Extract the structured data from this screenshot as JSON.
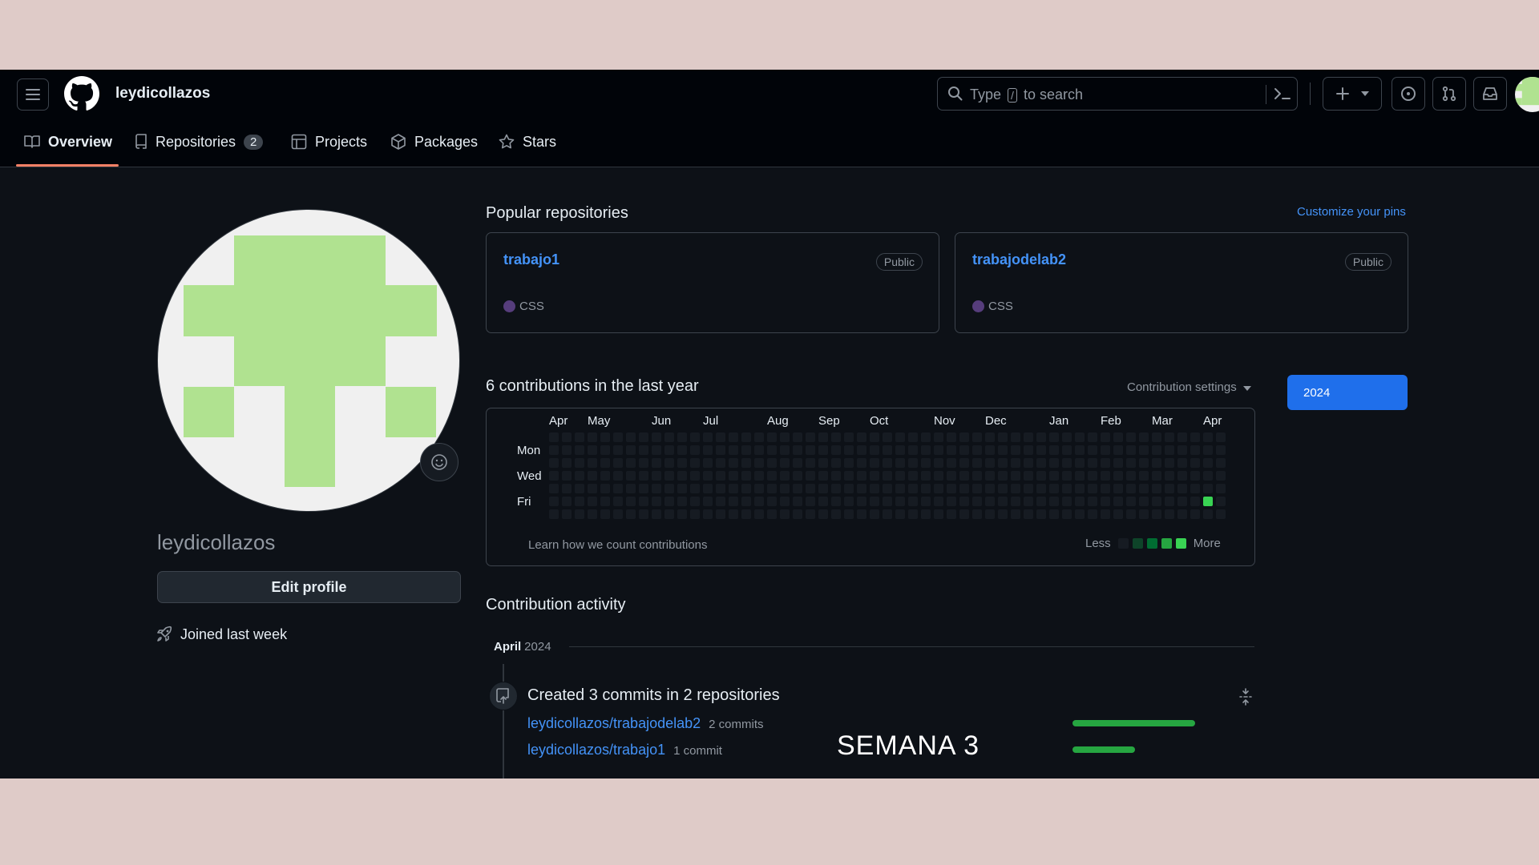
{
  "header": {
    "username": "leydicollazos",
    "search": {
      "prefix": "Type",
      "key": "/",
      "suffix": "to search"
    }
  },
  "tabs": {
    "overview": "Overview",
    "repositories": "Repositories",
    "repositories_count": "2",
    "projects": "Projects",
    "packages": "Packages",
    "stars": "Stars"
  },
  "profile": {
    "login": "leydicollazos",
    "edit_label": "Edit profile",
    "joined": "Joined last week"
  },
  "popular": {
    "title": "Popular repositories",
    "customize": "Customize your pins",
    "repos": [
      {
        "name": "trabajo1",
        "visibility": "Public",
        "language": "CSS",
        "language_color": "#563d7c"
      },
      {
        "name": "trabajodelab2",
        "visibility": "Public",
        "language": "CSS",
        "language_color": "#563d7c"
      }
    ]
  },
  "contributions": {
    "title": "6 contributions in the last year",
    "settings": "Contribution settings",
    "year": "2024",
    "months": [
      "Apr",
      "May",
      "Jun",
      "Jul",
      "Aug",
      "Sep",
      "Oct",
      "Nov",
      "Dec",
      "Jan",
      "Feb",
      "Mar",
      "Apr"
    ],
    "days": [
      "Mon",
      "Wed",
      "Fri"
    ],
    "learn": "Learn how we count contributions",
    "less": "Less",
    "more": "More",
    "weeks": 53,
    "active_cells": [
      {
        "week": 51,
        "day": 5,
        "level": 4
      }
    ],
    "colors": {
      "level0": "#161b22",
      "level1": "#0e4429",
      "level2": "#006d32",
      "level3": "#26a641",
      "level4": "#39d353"
    }
  },
  "activity": {
    "title": "Contribution activity",
    "month": "April",
    "year": "2024",
    "heading": "Created 3 commits in 2 repositories",
    "rows": [
      {
        "repo": "leydicollazos/trabajodelab2",
        "count": "2 commits",
        "commits": 2
      },
      {
        "repo": "leydicollazos/trabajo1",
        "count": "1 commit",
        "commits": 1
      }
    ]
  },
  "overlay": {
    "caption": "SEMANA 3"
  }
}
